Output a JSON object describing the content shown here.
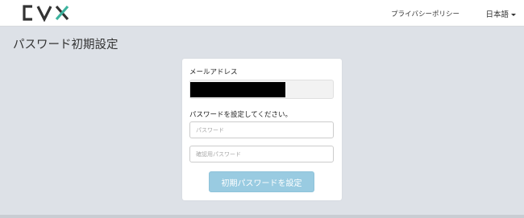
{
  "header": {
    "logo_text": "CVX",
    "logo_accent_color": "#3db39e",
    "privacy_link": "プライバシーポリシー",
    "language_label": "日本語"
  },
  "page": {
    "title": "パスワード初期設定"
  },
  "form": {
    "email_label": "メールアドレス",
    "email_value_redacted": true,
    "instruction": "パスワードを設定してください。",
    "password_placeholder": "パスワード",
    "confirm_placeholder": "確認用パスワード",
    "submit_label": "初期パスワードを設定"
  },
  "colors": {
    "background": "#dde1e7",
    "button": "#99cbe1"
  }
}
